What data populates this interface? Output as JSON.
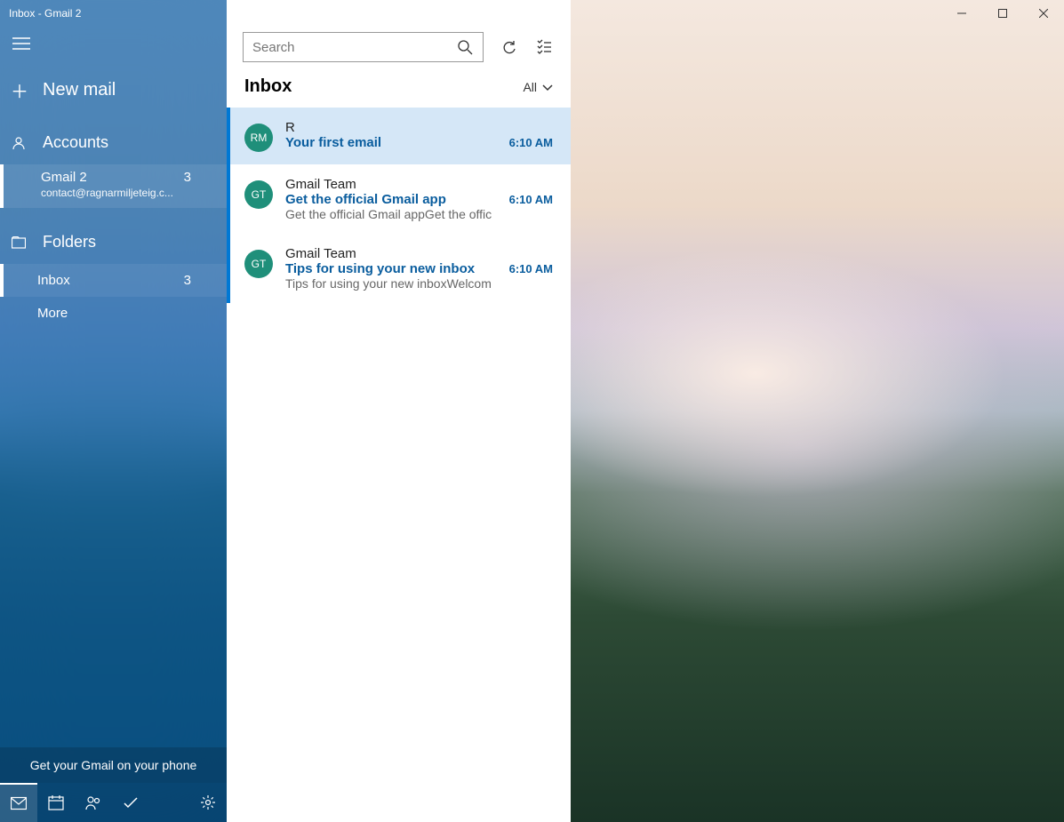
{
  "window": {
    "title": "Inbox - Gmail 2"
  },
  "sidebar": {
    "new_mail": "New mail",
    "accounts_label": "Accounts",
    "account": {
      "name": "Gmail 2",
      "badge": "3",
      "email": "contact@ragnarmiljeteig.c..."
    },
    "folders_label": "Folders",
    "inbox": {
      "label": "Inbox",
      "badge": "3"
    },
    "more": "More",
    "promo": "Get your Gmail on your phone"
  },
  "toolbar": {
    "search_placeholder": "Search"
  },
  "list": {
    "title": "Inbox",
    "filter": "All",
    "messages": [
      {
        "initials": "RM",
        "color": "#1f8f7a",
        "sender": "R",
        "subject": "Your first email",
        "time": "6:10 AM",
        "preview": "",
        "selected": true
      },
      {
        "initials": "GT",
        "color": "#1f8f7a",
        "sender": "Gmail Team",
        "subject": "Get the official Gmail app",
        "time": "6:10 AM",
        "preview": "Get the official Gmail appGet the offic",
        "selected": false
      },
      {
        "initials": "GT",
        "color": "#1f8f7a",
        "sender": "Gmail Team",
        "subject": "Tips for using your new inbox",
        "time": "6:10 AM",
        "preview": "Tips for using your new inboxWelcom",
        "selected": false
      }
    ]
  }
}
